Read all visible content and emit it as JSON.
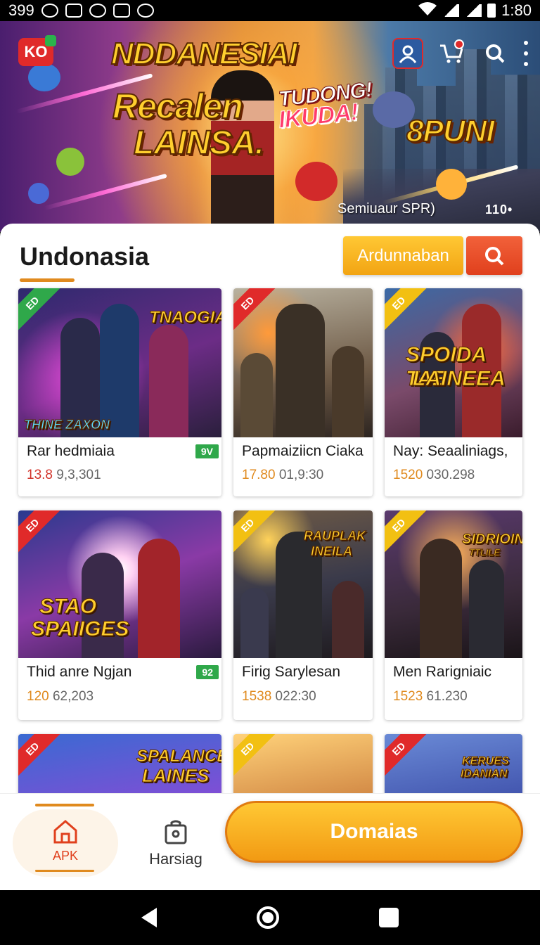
{
  "status_bar": {
    "left_text": "399",
    "time": "1:80",
    "icons": [
      "clock-icon",
      "cast-icon",
      "notification-icon",
      "gallery-icon",
      "shield-icon",
      "wifi-icon",
      "signal-icon",
      "signal-icon",
      "battery-icon"
    ]
  },
  "hero": {
    "logo_text": "KO",
    "title_line1": "NDDANESIAI",
    "title_line2": "Recalen",
    "title_line3": "LAINSA.",
    "promo_line1": "TUDONG!",
    "promo_line2": "IKUDA!",
    "right_title": "8PUNI",
    "caption": "Semiuaur SPR)",
    "pager": "110•",
    "actions": [
      "user-icon",
      "cart-icon",
      "search-icon",
      "more-icon"
    ]
  },
  "section": {
    "title": "Undonasia",
    "action_button": "Ardunnaban",
    "search_button_icon": "search-icon"
  },
  "colors": {
    "accent_orange": "#f2a413",
    "search_red": "#e0401d",
    "tag_green": "#2fa84a",
    "ribbon_red": "#e02a2a",
    "ribbon_yellow": "#f2c012"
  },
  "cards": [
    {
      "name": "Rar hedmiaia",
      "stats_hi": "13.8",
      "stats_rest": " 9,3,301",
      "tag": "9V",
      "ribbon": "ED",
      "art_title": "TNAOGIAN",
      "art_sub": "THINE ZAXON"
    },
    {
      "name": "Papmaiziicn Ciaka",
      "stats_hi": "17.80",
      "stats_rest": " 01,9:30",
      "tag": "",
      "ribbon": "ED",
      "art_title": "",
      "art_sub": ""
    },
    {
      "name": "Nay: Seaaliniags,",
      "stats_hi": "1520",
      "stats_rest": " 030.298",
      "tag": "",
      "ribbon": "ED",
      "art_title": "SPOIDA TAE",
      "art_sub": "LAINEEA"
    },
    {
      "name": "Thid anre Ngjan",
      "stats_hi": "120",
      "stats_rest": " 62,203",
      "tag": "92",
      "ribbon": "ED",
      "art_title": "STAO",
      "art_sub": "SPAIIGES"
    },
    {
      "name": "Firig Sarylesan",
      "stats_hi": "1538",
      "stats_rest": " 022:30",
      "tag": "",
      "ribbon": "ED",
      "art_title": "RAUPLAK",
      "art_sub": "INEILA"
    },
    {
      "name": "Men Rarigniaic",
      "stats_hi": "1523",
      "stats_rest": " 61.230",
      "tag": "",
      "ribbon": "ED",
      "art_title": "SIDRIOIN",
      "art_sub": "TTLILE"
    }
  ],
  "partial_cards": [
    {
      "ribbon": "ED",
      "art_title": "SPALANCE",
      "art_sub": "LAINES"
    },
    {
      "ribbon": "ED",
      "art_title": "",
      "art_sub": ""
    },
    {
      "ribbon": "ED",
      "art_title": "KERUES",
      "art_sub": "IDANIAN"
    }
  ],
  "bottom_nav": {
    "apk_label": "APK",
    "harsiag_label": "Harsiag",
    "cta_label": "Domaias"
  }
}
